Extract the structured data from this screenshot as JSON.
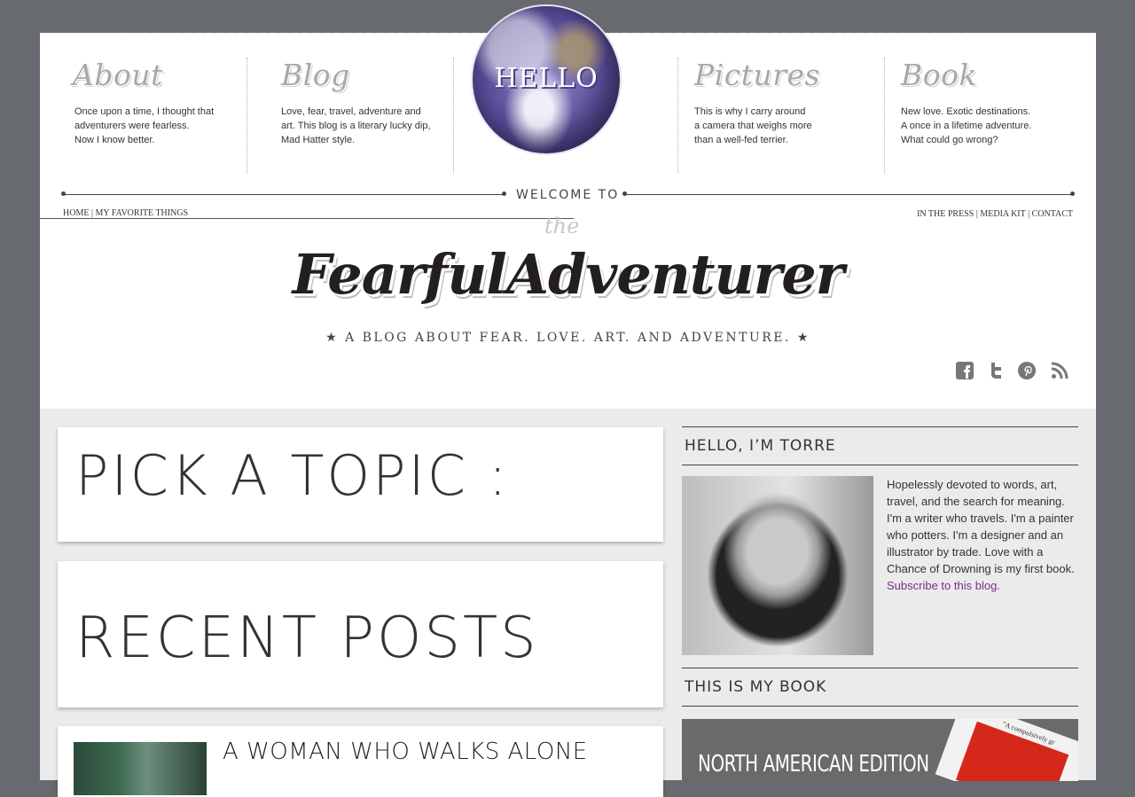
{
  "top_nav": [
    {
      "title": "About",
      "description": "Once upon a time, I thought that\nadventurers were fearless.\nNow I know better."
    },
    {
      "title": "Blog",
      "description": "Love, fear, travel, adventure and\nart. This blog is a literary lucky dip,\nMad Hatter style."
    },
    {
      "title": "Pictures",
      "description": "This is why I carry around\na camera that weighs more\nthan a well-fed terrier."
    },
    {
      "title": "Book",
      "description": "New love. Exotic destinations.\nA once in a lifetime adventure.\nWhat could go wrong?"
    }
  ],
  "globe_label": "HELLO",
  "welcome_text": "WELCOME TO",
  "links_left": {
    "home": "HOME",
    "separator": "|",
    "favorites": "MY FAVORITE THINGS"
  },
  "links_right": {
    "press": "IN THE PRESS",
    "sep1": "|",
    "media": "MEDIA KIT",
    "sep2": "|",
    "contact": "CONTACT"
  },
  "logo": {
    "the": "the",
    "name": "FearfulAdventurer",
    "tagline": "★ A BLOG ABOUT FEAR. LOVE. ART. AND ADVENTURE. ★"
  },
  "social_icons": [
    "facebook-icon",
    "twitter-icon",
    "pinterest-icon",
    "rss-icon"
  ],
  "main": {
    "pick_topic": "PICK A TOPIC :",
    "recent_posts": "RECENT POSTS",
    "first_post_title": "A WOMAN WHO WALKS ALONE"
  },
  "sidebar": {
    "hello_heading": "HELLO, I’M TORRE",
    "bio": "Hopelessly devoted to words, art, travel, and the search for meaning. I'm a writer who travels. I'm a painter who potters. I'm a designer and an illustrator by trade. Love with a Chance of Drowning is my first book.",
    "subscribe_link": "Subscribe to this blog.",
    "book_heading": "THIS IS MY BOOK",
    "book_edition": "NORTH AMERICAN EDITION",
    "book_quote": "\"A compulsively gr"
  },
  "colors": {
    "background": "#676a6f",
    "accent_link": "#7b2b8c",
    "content_bg": "#ebebeb"
  }
}
